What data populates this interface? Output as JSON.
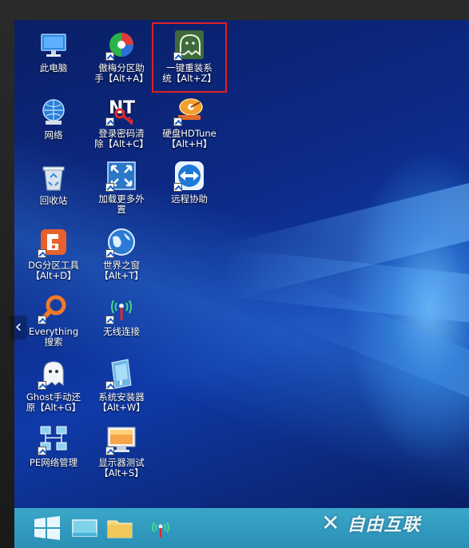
{
  "desktop": {
    "icons": [
      {
        "name": "this-pc",
        "label": "此电脑"
      },
      {
        "name": "diskgenius-partition",
        "label": "傲梅分区助\n手【Alt+A】"
      },
      {
        "name": "one-key-reinstall",
        "label": "一键重装系\n统【Alt+Z】"
      },
      {
        "name": "network",
        "label": "网络"
      },
      {
        "name": "login-password-clear",
        "label": "登录密码清\n除【Alt+C】"
      },
      {
        "name": "hdtune",
        "label": "硬盘HDTune\n【Alt+H】"
      },
      {
        "name": "recycle-bin",
        "label": "回收站"
      },
      {
        "name": "load-more-external",
        "label": "加载更多外\n置"
      },
      {
        "name": "remote-assist",
        "label": "远程协助"
      },
      {
        "name": "dg-partition-tool",
        "label": "DG分区工具\n【Alt+D】"
      },
      {
        "name": "world-window",
        "label": "世界之窗\n【Alt+T】"
      },
      {
        "name": "everything-search",
        "label": "Everything\n搜索"
      },
      {
        "name": "wireless-connect",
        "label": "无线连接"
      },
      {
        "name": "ghost-manual-restore",
        "label": "Ghost手动还\n原【Alt+G】"
      },
      {
        "name": "system-installer",
        "label": "系统安装器\n【Alt+W】"
      },
      {
        "name": "pe-network-manager",
        "label": "PE网络管理"
      },
      {
        "name": "monitor-test",
        "label": "显示器测试\n【Alt+S】"
      }
    ]
  },
  "taskbar": {
    "items": [
      "start-button",
      "desktop-button",
      "explorer-button",
      "wifi-tray"
    ]
  },
  "overlay": {
    "chevron": "‹",
    "watermark": "自由互联"
  },
  "colors": {
    "taskbar": "#2b8fb5",
    "highlight": "#e02020",
    "wallpaper": "#0c2a86"
  }
}
